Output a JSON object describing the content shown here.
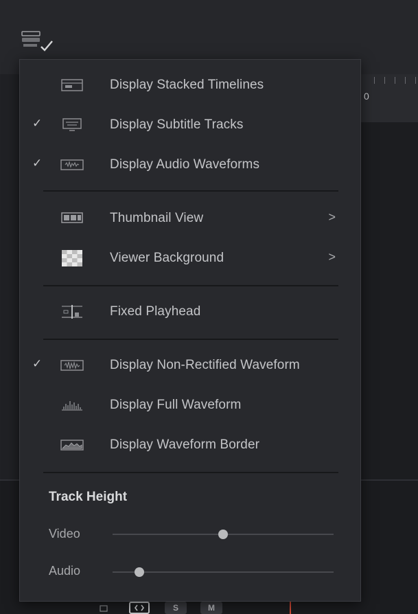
{
  "menu": {
    "items": [
      {
        "label": "Display Stacked Timelines",
        "checked": false,
        "icon": "stacked-timelines-icon"
      },
      {
        "label": "Display Subtitle Tracks",
        "checked": true,
        "icon": "subtitle-tracks-icon"
      },
      {
        "label": "Display Audio Waveforms",
        "checked": true,
        "icon": "audio-waveforms-icon"
      },
      {
        "label": "Thumbnail View",
        "checked": false,
        "icon": "thumbnail-view-icon",
        "submenu": true
      },
      {
        "label": "Viewer Background",
        "checked": false,
        "icon": "viewer-background-icon",
        "submenu": true
      },
      {
        "label": "Fixed Playhead",
        "checked": false,
        "icon": "fixed-playhead-icon"
      },
      {
        "label": "Display Non-Rectified Waveform",
        "checked": true,
        "icon": "non-rectified-waveform-icon"
      },
      {
        "label": "Display Full Waveform",
        "checked": false,
        "icon": "full-waveform-icon"
      },
      {
        "label": "Display Waveform Border",
        "checked": false,
        "icon": "waveform-border-icon"
      }
    ],
    "check_glyph": "✓",
    "chevron_glyph": ">"
  },
  "track_height": {
    "title": "Track Height",
    "video": {
      "label": "Video",
      "value": 0.5
    },
    "audio": {
      "label": "Audio",
      "value": 0.12
    }
  },
  "timeline": {
    "ruler_label": "0",
    "buttons": {
      "s": "S",
      "m": "M"
    }
  },
  "colors": {
    "menu_bg": "#28292d",
    "text": "#c4c5c8",
    "playhead": "#d44a36"
  }
}
